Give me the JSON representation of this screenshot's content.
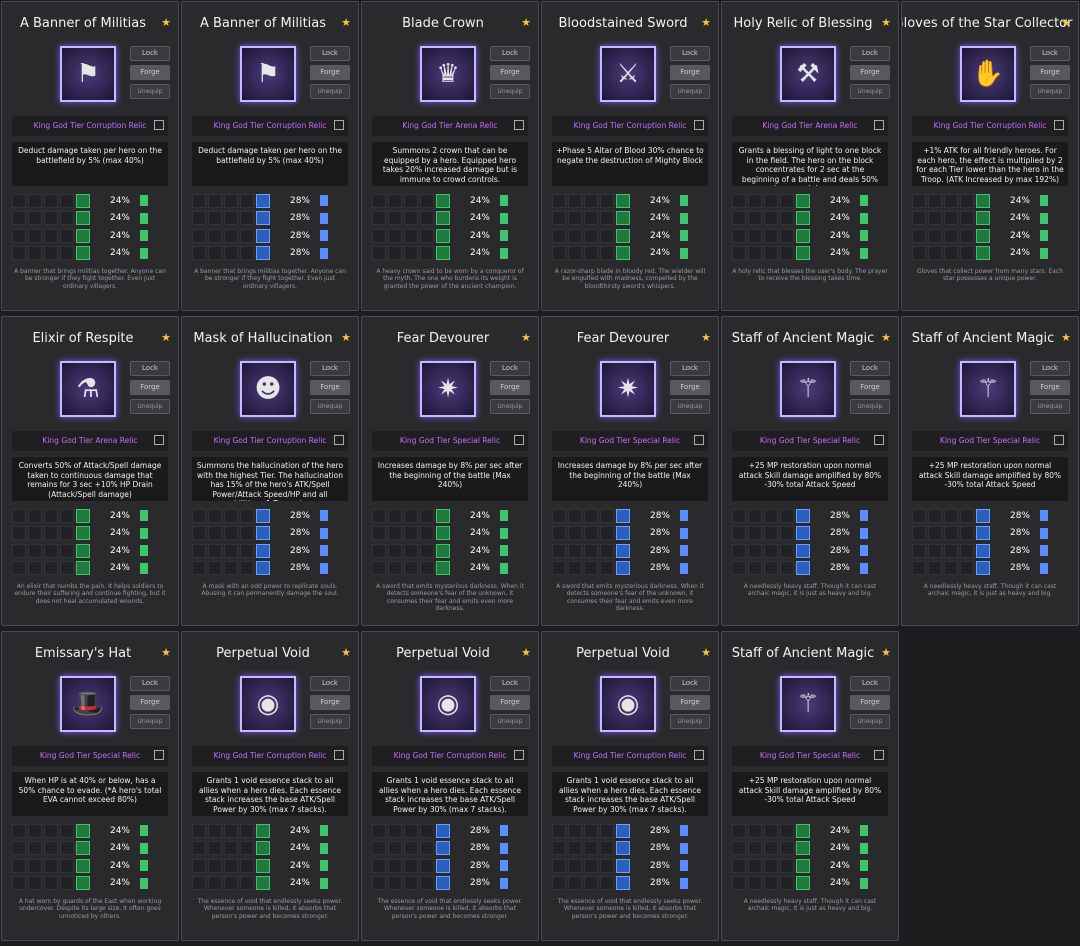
{
  "ui": {
    "lock_label": "Lock",
    "forge_label": "Forge",
    "unequip_label": "Unequip"
  },
  "colors": {
    "tier_purple": "#c86bff",
    "highlight_purple": "#d76bff",
    "debuff_red": "#ff4d4d",
    "upgrade_green": "#3ec46e",
    "upgrade_blue": "#5a8dff",
    "star_gold": "#f5c63a"
  },
  "cards": [
    {
      "name": "A Banner of Militias",
      "tier": "King God Tier Corruption Relic",
      "icon": "banner-icon",
      "desc": "Deduct damage taken per hero on the battlefield by 5% (max 40%)",
      "stats": [
        {
          "value": "24%",
          "color": "green"
        },
        {
          "value": "24%",
          "color": "green"
        },
        {
          "value": "24%",
          "color": "green"
        },
        {
          "value": "24%",
          "color": "green"
        }
      ],
      "flavor": "A banner that brings militias together. Anyone can be stronger if they fight together. Even just ordinary villagers."
    },
    {
      "name": "A Banner of Militias",
      "tier": "King God Tier Corruption Relic",
      "icon": "banner-icon",
      "desc": "Deduct damage taken per hero on the battlefield by 5% (max 40%)",
      "stats": [
        {
          "value": "28%",
          "color": "blue"
        },
        {
          "value": "28%",
          "color": "blue"
        },
        {
          "value": "28%",
          "color": "blue"
        },
        {
          "value": "28%",
          "color": "blue"
        }
      ],
      "flavor": "A banner that brings militias together. Anyone can be stronger if they fight together. Even just ordinary villagers."
    },
    {
      "name": "Blade Crown",
      "tier": "King God Tier Arena Relic",
      "icon": "crown-icon",
      "desc": "Summons 2 crown that can be equipped by a hero. Equipped hero takes 20% increased damage but is immune to crowd controls.",
      "stats": [
        {
          "value": "24%",
          "color": "green"
        },
        {
          "value": "24%",
          "color": "green"
        },
        {
          "value": "24%",
          "color": "green"
        },
        {
          "value": "24%",
          "color": "green"
        }
      ],
      "flavor": "A heavy crown said to be worn by a conqueror of the myth. The one who burdens its weight is granted the power of the ancient champion."
    },
    {
      "name": "Bloodstained Sword",
      "tier": "King God Tier Corruption Relic",
      "icon": "sword-icon",
      "desc": "+Phase 5 Altar of Blood 30% chance to negate the destruction of Mighty Block",
      "stats": [
        {
          "value": "24%",
          "color": "green"
        },
        {
          "value": "24%",
          "color": "green"
        },
        {
          "value": "24%",
          "color": "green"
        },
        {
          "value": "24%",
          "color": "green"
        }
      ],
      "flavor": "A razor-sharp blade in bloody red. The wielder will be engulfed with madness, compelled by the bloodthirsty sword's whispers."
    },
    {
      "name": "Holy Relic of Blessing",
      "tier": "King God Tier Arena Relic",
      "icon": "hammer-icon",
      "desc": "Grants a blessing of light to one block in the field. The hero on the block concentrates for 2 sec at the beginning of a battle and deals 50% increased damage.",
      "stats": [
        {
          "value": "24%",
          "color": "green"
        },
        {
          "value": "24%",
          "color": "green"
        },
        {
          "value": "24%",
          "color": "green"
        },
        {
          "value": "24%",
          "color": "green"
        }
      ],
      "flavor": "A holy relic that blesses the user's body. The prayer to receive the blessing takes time."
    },
    {
      "name": "Gloves of the Star Collector",
      "tier": "King God Tier Corruption Relic",
      "icon": "gloves-icon",
      "desc": "+1% ATK for all friendly heroes. For each hero, the effect is multiplied by 2 for each Tier lower than the hero in the Troop. (ATK Increased by max 192%)",
      "stats": [
        {
          "value": "24%",
          "color": "green"
        },
        {
          "value": "24%",
          "color": "green"
        },
        {
          "value": "24%",
          "color": "green"
        },
        {
          "value": "24%",
          "color": "green"
        }
      ],
      "flavor": "Gloves that collect power from many stars. Each star possesses a unique power."
    },
    {
      "name": "Elixir of Respite",
      "tier": "King God Tier Arena Relic",
      "icon": "potion-icon",
      "desc": "Converts 50% of Attack/Spell damage taken to continuous damage that remains for 3 sec +10% HP Drain (Attack/Spell damage)",
      "stats": [
        {
          "value": "24%",
          "color": "green"
        },
        {
          "value": "24%",
          "color": "green"
        },
        {
          "value": "24%",
          "color": "green"
        },
        {
          "value": "24%",
          "color": "green"
        }
      ],
      "flavor": "An elixir that numbs the pain. It helps soldiers to endure their suffering and continue fighting, but it does not heal accumulated wounds."
    },
    {
      "name": "Mask of Hallucination",
      "tier": "King God Tier Corruption Relic",
      "icon": "mask-icon",
      "desc": "Summons the hallucination of the hero with the highest Tier. The hallucination has 15% of the hero's ATK/Spell Power/Attack Speed/HP and all abilities. -1 Troop size",
      "stats": [
        {
          "value": "28%",
          "color": "blue"
        },
        {
          "value": "28%",
          "color": "blue"
        },
        {
          "value": "28%",
          "color": "blue"
        },
        {
          "value": "28%",
          "color": "blue"
        }
      ],
      "flavor": "A mask with an odd power to replicate souls. Abusing it can permanently damage the soul."
    },
    {
      "name": "Fear Devourer",
      "tier": "King God Tier Special Relic",
      "icon": "devourer-icon",
      "desc": "Increases damage by 8% per sec after the beginning of the battle (Max 240%)",
      "stats": [
        {
          "value": "24%",
          "color": "green"
        },
        {
          "value": "24%",
          "color": "green"
        },
        {
          "value": "24%",
          "color": "green"
        },
        {
          "value": "24%",
          "color": "green"
        }
      ],
      "flavor": "A sword that emits mysterious darkness. When it detects someone's fear of the unknown, it consumes their fear and emits even more darkness."
    },
    {
      "name": "Fear Devourer",
      "tier": "King God Tier Special Relic",
      "icon": "devourer-icon",
      "desc": "Increases damage by 8% per sec after the beginning of the battle (Max 240%)",
      "stats": [
        {
          "value": "28%",
          "color": "blue"
        },
        {
          "value": "28%",
          "color": "blue"
        },
        {
          "value": "28%",
          "color": "blue"
        },
        {
          "value": "28%",
          "color": "blue"
        }
      ],
      "flavor": "A sword that emits mysterious darkness. When it detects someone's fear of the unknown, it consumes their fear and emits even more darkness."
    },
    {
      "name": "Staff of Ancient Magic",
      "tier": "King God Tier Special Relic",
      "icon": "staff-icon",
      "desc": "+25 MP restoration upon normal attack Skill damage amplified by 80% -30% total Attack Speed",
      "stats": [
        {
          "value": "28%",
          "color": "blue"
        },
        {
          "value": "28%",
          "color": "blue"
        },
        {
          "value": "28%",
          "color": "blue"
        },
        {
          "value": "28%",
          "color": "blue"
        }
      ],
      "flavor": "A needlessly heavy staff. Though it can cast archaic magic, it is just as heavy and big."
    },
    {
      "name": "Staff of Ancient Magic",
      "tier": "King God Tier Special Relic",
      "icon": "staff-icon",
      "desc": "+25 MP restoration upon normal attack Skill damage amplified by 80% -30% total Attack Speed",
      "stats": [
        {
          "value": "28%",
          "color": "blue"
        },
        {
          "value": "28%",
          "color": "blue"
        },
        {
          "value": "28%",
          "color": "blue"
        },
        {
          "value": "28%",
          "color": "blue"
        }
      ],
      "flavor": "A needlessly heavy staff. Though it can cast archaic magic, it is just as heavy and big."
    },
    {
      "name": "Emissary's Hat",
      "tier": "King God Tier Special Relic",
      "icon": "hat-icon",
      "desc": "When HP is at 40% or below, has a 50% chance to evade. (*A hero's total EVA cannot exceed 80%)",
      "stats": [
        {
          "value": "24%",
          "color": "green"
        },
        {
          "value": "24%",
          "color": "green"
        },
        {
          "value": "24%",
          "color": "green"
        },
        {
          "value": "24%",
          "color": "green"
        }
      ],
      "flavor": "A hat worn by guards of the East when working undercover. Despite its large size, it often goes unnoticed by others."
    },
    {
      "name": "Perpetual Void",
      "tier": "King God Tier Corruption Relic",
      "icon": "void-icon",
      "desc": "Grants 1 void essence stack to all allies when a hero dies. Each essence stack increases the base ATK/Spell Power by 30% (max 7 stacks).",
      "stats": [
        {
          "value": "24%",
          "color": "green"
        },
        {
          "value": "24%",
          "color": "green"
        },
        {
          "value": "24%",
          "color": "green"
        },
        {
          "value": "24%",
          "color": "green"
        }
      ],
      "flavor": "The essence of void that endlessly seeks power. Whenever someone is killed, it absorbs that person's power and becomes stronger."
    },
    {
      "name": "Perpetual Void",
      "tier": "King God Tier Corruption Relic",
      "icon": "void-icon",
      "desc": "Grants 1 void essence stack to all allies when a hero dies. Each essence stack increases the base ATK/Spell Power by 30% (max 7 stacks).",
      "stats": [
        {
          "value": "28%",
          "color": "blue"
        },
        {
          "value": "28%",
          "color": "blue"
        },
        {
          "value": "28%",
          "color": "blue"
        },
        {
          "value": "28%",
          "color": "blue"
        }
      ],
      "flavor": "The essence of void that endlessly seeks power. Whenever someone is killed, it absorbs that person's power and becomes stronger."
    },
    {
      "name": "Perpetual Void",
      "tier": "King God Tier Corruption Relic",
      "icon": "void-icon",
      "desc": "Grants 1 void essence stack to all allies when a hero dies. Each essence stack increases the base ATK/Spell Power by 30% (max 7 stacks).",
      "stats": [
        {
          "value": "28%",
          "color": "blue"
        },
        {
          "value": "28%",
          "color": "blue"
        },
        {
          "value": "28%",
          "color": "blue"
        },
        {
          "value": "28%",
          "color": "blue"
        }
      ],
      "flavor": "The essence of void that endlessly seeks power. Whenever someone is killed, it absorbs that person's power and becomes stronger."
    },
    {
      "name": "Staff of Ancient Magic",
      "tier": "King God Tier Special Relic",
      "icon": "staff-icon",
      "desc": "+25 MP restoration upon normal attack Skill damage amplified by 80% -30% total Attack Speed",
      "stats": [
        {
          "value": "24%",
          "color": "green"
        },
        {
          "value": "24%",
          "color": "green"
        },
        {
          "value": "24%",
          "color": "green"
        },
        {
          "value": "24%",
          "color": "green"
        }
      ],
      "flavor": "A needlessly heavy staff. Though it can cast archaic magic, it is just as heavy and big."
    }
  ]
}
